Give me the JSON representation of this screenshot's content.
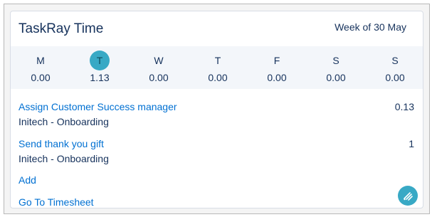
{
  "header": {
    "title": "TaskRay Time",
    "week_label": "Week of 30 May"
  },
  "week": {
    "days": [
      {
        "letter": "M",
        "hours": "0.00",
        "active": false
      },
      {
        "letter": "T",
        "hours": "1.13",
        "active": true
      },
      {
        "letter": "W",
        "hours": "0.00",
        "active": false
      },
      {
        "letter": "T",
        "hours": "0.00",
        "active": false
      },
      {
        "letter": "F",
        "hours": "0.00",
        "active": false
      },
      {
        "letter": "S",
        "hours": "0.00",
        "active": false
      },
      {
        "letter": "S",
        "hours": "0.00",
        "active": false
      }
    ]
  },
  "tasks": [
    {
      "name": "Assign Customer Success manager",
      "project": "Initech - Onboarding",
      "hours": "0.13"
    },
    {
      "name": "Send thank you gift",
      "project": "Initech - Onboarding",
      "hours": "1"
    }
  ],
  "actions": {
    "add_label": "Add",
    "timesheet_label": "Go To Timesheet"
  },
  "icons": {
    "fab_icon": "stopwatch-lines-icon"
  },
  "colors": {
    "accent": "#38a9c5",
    "link": "#0070d2",
    "text": "#16325c",
    "strip_bg": "#f3f6fa"
  }
}
